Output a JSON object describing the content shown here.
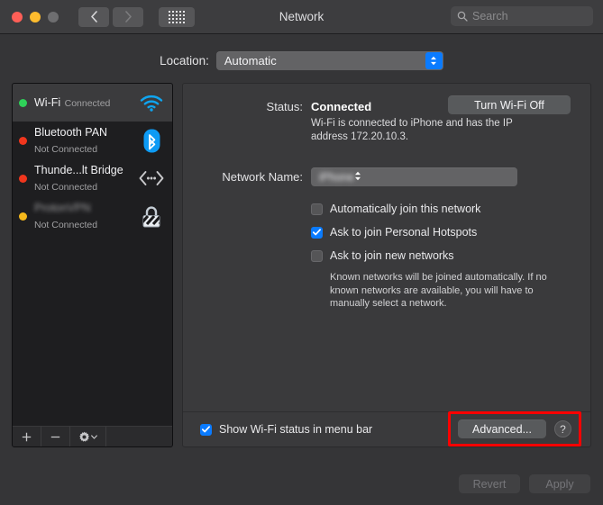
{
  "window": {
    "title": "Network",
    "traffic_lights": [
      "close",
      "minimize",
      "zoom"
    ]
  },
  "toolbar": {
    "back_icon": "chevron-left-icon",
    "forward_icon": "chevron-right-icon",
    "grid_icon": "show-all-grid-icon",
    "search_placeholder": "Search",
    "search_value": ""
  },
  "location": {
    "label": "Location:",
    "value": "Automatic",
    "options": [
      "Automatic"
    ]
  },
  "sidebar": {
    "services": [
      {
        "name": "Wi-Fi",
        "status": "Connected",
        "led": "green",
        "icon": "wifi-icon",
        "selected": true,
        "redacted": false
      },
      {
        "name": "Bluetooth PAN",
        "status": "Not Connected",
        "led": "red",
        "icon": "bluetooth-icon",
        "selected": false,
        "redacted": false
      },
      {
        "name": "Thunde...lt Bridge",
        "status": "Not Connected",
        "led": "red",
        "icon": "thunderbolt-bridge-icon",
        "selected": false,
        "redacted": false
      },
      {
        "name": "ProtonVPN",
        "status": "Not Connected",
        "led": "yellow",
        "icon": "vpn-lock-icon",
        "selected": false,
        "redacted": true
      }
    ],
    "toolbar": {
      "add_label": "+",
      "remove_label": "−",
      "action_icon": "gear-icon",
      "action_chevron": "chevron-down-icon"
    }
  },
  "detail": {
    "status_label": "Status:",
    "status_value": "Connected",
    "status_description": "Wi-Fi is connected to iPhone and has the IP address 172.20.10.3.",
    "turn_off_button": "Turn Wi-Fi Off",
    "network_name_label": "Network Name:",
    "network_name_value": "iPhone",
    "checkboxes": [
      {
        "label": "Automatically join this network",
        "checked": false
      },
      {
        "label": "Ask to join Personal Hotspots",
        "checked": true
      },
      {
        "label": "Ask to join new networks",
        "checked": false
      }
    ],
    "hint": "Known networks will be joined automatically. If no known networks are available, you will have to manually select a network.",
    "show_status_label": "Show Wi-Fi status in menu bar",
    "show_status_checked": true,
    "advanced_button": "Advanced...",
    "help_button": "?"
  },
  "footer": {
    "revert_label": "Revert",
    "revert_enabled": false,
    "apply_label": "Apply",
    "apply_enabled": false
  },
  "colors": {
    "accent_blue": "#0a7bff",
    "highlight_red": "#ff0000",
    "led_green": "#2fd159",
    "led_red": "#f0361d",
    "led_yellow": "#f5b81b",
    "window_bg": "#353537",
    "sidebar_bg": "#1e1e20",
    "detail_bg": "#3a3a3c"
  }
}
